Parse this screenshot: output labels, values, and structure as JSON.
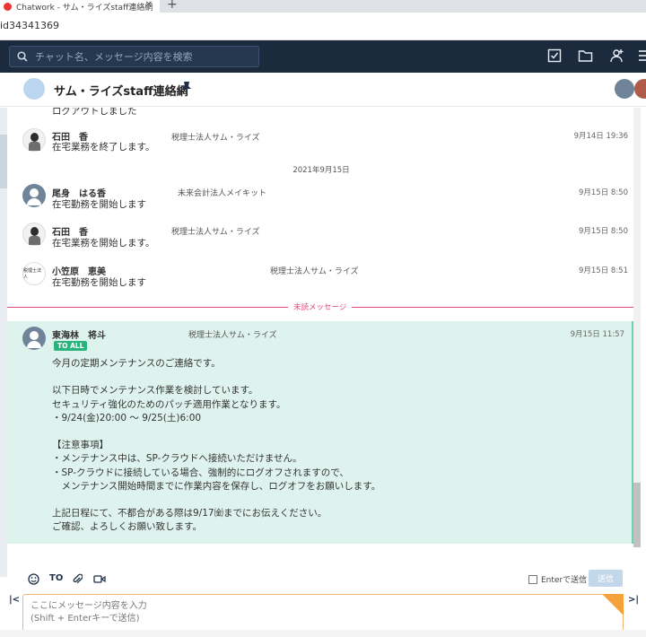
{
  "browser": {
    "tab_title": "Chatwork - サム・ライズstaff連絡網",
    "tab_close": "✕",
    "new_tab": "+",
    "url": "id34341369"
  },
  "app": {
    "search_placeholder": "チャット名、メッセージ内容を検索"
  },
  "room": {
    "title": "サム・ライズstaff連絡網"
  },
  "timeline": {
    "top_partial": "ログアウトしました",
    "messages_before": [
      {
        "sender": "石田　香",
        "org": "税理士法人サム・ライズ",
        "time": "9月14日 19:36",
        "body": "在宅業務を終了します。",
        "avatar": "photo"
      }
    ],
    "date_separator": "2021年9月15日",
    "messages_after": [
      {
        "sender": "尾身　はる香",
        "org": "未来会計法人メイキット",
        "time": "9月15日 8:50",
        "body": "在宅勤務を開始します",
        "avatar": "gray"
      },
      {
        "sender": "石田　香",
        "org": "税理士法人サム・ライズ",
        "time": "9月15日 8:50",
        "body": "在宅業務を開始します。",
        "avatar": "photo"
      },
      {
        "sender": "小笠原　恵美",
        "org": "税理士法人サム・ライズ",
        "time": "9月15日 8:51",
        "body": "在宅勤務を開始します",
        "avatar": "logo",
        "avatar_text": "税理士法人"
      }
    ],
    "unread_label": "未読メッセージ",
    "highlighted": {
      "sender": "東海林　将斗",
      "org": "税理士法人サム・ライズ",
      "time": "9月15日 11:57",
      "badge": "TO ALL",
      "body": "今月の定期メンテナンスのご連絡です。\n\n以下日時でメンテナンス作業を検討しています。\nセキュリティ強化のためのパッチ適用作業となります。\n・9/24(金)20:00 ～ 9/25(土)6:00\n\n【注意事項】\n・メンテナンス中は、SP-クラウドへ接続いただけません。\n・SP-クラウドに接続している場合、強制的にログオフされますので、\n　メンテナンス開始時間までに作業内容を保存し、ログオフをお願いします。\n\n上記日程にて、不都合がある際は9/17㈮までにお伝えください。\nご確認、よろしくお願い致します。"
    }
  },
  "composer": {
    "to_label": "TO",
    "enter_send_label": "Enterで送信",
    "send_label": "送信",
    "placeholder_line1": "ここにメッセージ内容を入力",
    "placeholder_line2": "(Shift + Enterキーで送信)",
    "left_arrow": "|<",
    "right_arrow": ">|"
  }
}
